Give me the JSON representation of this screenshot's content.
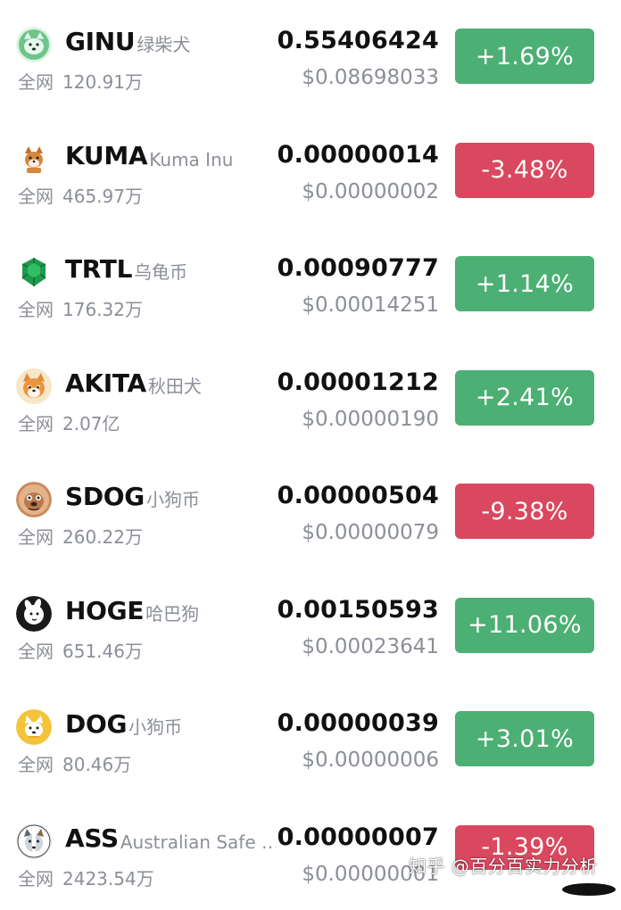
{
  "colors": {
    "up": "#4caf73",
    "down": "#d9485f",
    "muted": "#8b8f97"
  },
  "volume_label": "全网",
  "coins": [
    {
      "icon": "shiba-green-icon",
      "symbol": "GINU",
      "name": "绿柴犬",
      "volume": "120.91万",
      "price": "0.55406424",
      "usd": "$0.08698033",
      "change": "+1.69%",
      "direction": "up"
    },
    {
      "icon": "kuma-dog-icon",
      "symbol": "KUMA",
      "name": "Kuma Inu",
      "volume": "465.97万",
      "price": "0.00000014",
      "usd": "$0.00000002",
      "change": "-3.48%",
      "direction": "down"
    },
    {
      "icon": "turtle-shell-icon",
      "symbol": "TRTL",
      "name": "乌龟币",
      "volume": "176.32万",
      "price": "0.00090777",
      "usd": "$0.00014251",
      "change": "+1.14%",
      "direction": "up"
    },
    {
      "icon": "akita-dog-icon",
      "symbol": "AKITA",
      "name": "秋田犬",
      "volume": "2.07亿",
      "price": "0.00001212",
      "usd": "$0.00000190",
      "change": "+2.41%",
      "direction": "up"
    },
    {
      "icon": "sdog-dog-icon",
      "symbol": "SDOG",
      "name": "小狗币",
      "volume": "260.22万",
      "price": "0.00000504",
      "usd": "$0.00000079",
      "change": "-9.38%",
      "direction": "down"
    },
    {
      "icon": "hoge-rabbit-icon",
      "symbol": "HOGE",
      "name": "哈巴狗",
      "volume": "651.46万",
      "price": "0.00150593",
      "usd": "$0.00023641",
      "change": "+11.06%",
      "direction": "up"
    },
    {
      "icon": "dog-yellow-icon",
      "symbol": "DOG",
      "name": "小狗币",
      "volume": "80.46万",
      "price": "0.00000039",
      "usd": "$0.00000006",
      "change": "+3.01%",
      "direction": "up"
    },
    {
      "icon": "ass-dog-icon",
      "symbol": "ASS",
      "name": "Australian Safe Sh...",
      "volume": "2423.54万",
      "price": "0.00000007",
      "usd": "$0.00000001",
      "change": "-1.39%",
      "direction": "down"
    }
  ],
  "watermark": "知乎 @百分百实力分析"
}
